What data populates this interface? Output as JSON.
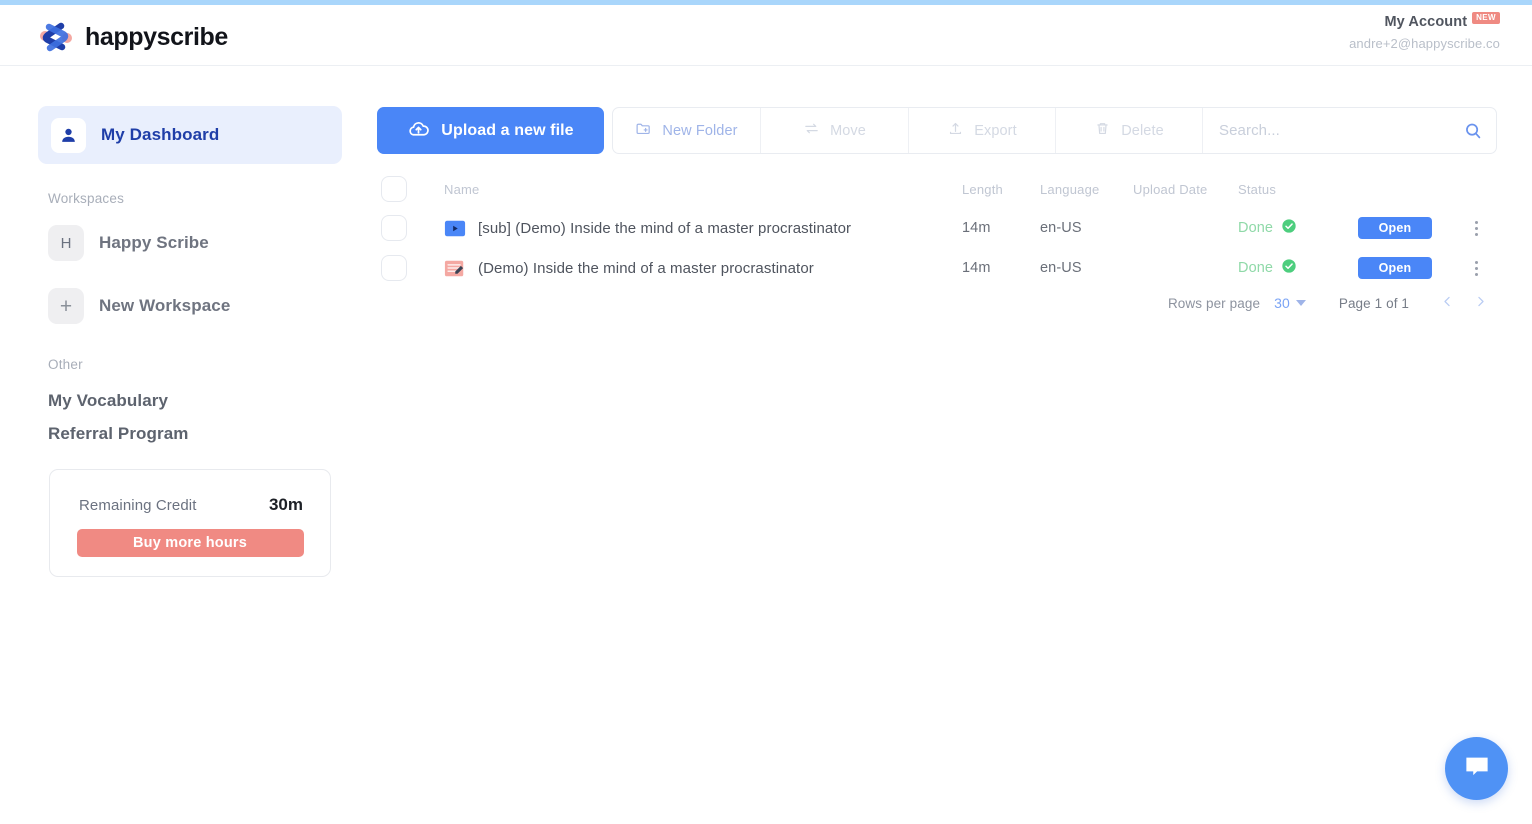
{
  "header": {
    "logo_text": "happyscribe",
    "logo_icon": "happyscribe-logo-icon",
    "account_name": "My Account",
    "new_badge": "NEW",
    "account_email": "andre+2@happyscribe.co"
  },
  "sidebar": {
    "dashboard": {
      "label": "My Dashboard",
      "icon": "person-icon"
    },
    "workspaces_label": "Workspaces",
    "workspaces": [
      {
        "initial": "H",
        "label": "Happy Scribe"
      },
      {
        "initial": "+",
        "label": "New Workspace"
      }
    ],
    "other_label": "Other",
    "other_links": [
      {
        "label": "My Vocabulary"
      },
      {
        "label": "Referral Program"
      }
    ],
    "credit": {
      "label": "Remaining Credit",
      "value": "30m",
      "buy_label": "Buy more hours"
    }
  },
  "toolbar": {
    "upload_label": "Upload a new file",
    "upload_icon": "cloud-upload-icon",
    "new_folder_label": "New Folder",
    "new_folder_icon": "folder-plus-icon",
    "move_label": "Move",
    "move_icon": "move-arrows-icon",
    "export_label": "Export",
    "export_icon": "export-upload-icon",
    "delete_label": "Delete",
    "delete_icon": "trash-icon",
    "search_placeholder": "Search...",
    "search_value": "",
    "search_icon": "search-icon"
  },
  "table": {
    "headers": {
      "name": "Name",
      "length": "Length",
      "language": "Language",
      "upload_date": "Upload Date",
      "status": "Status"
    },
    "rows": [
      {
        "icon": "video-subtitle-icon",
        "name": "[sub] (Demo) Inside the mind of a master procrastinator",
        "length": "14m",
        "language": "en-US",
        "upload_date": "",
        "status": "Done",
        "status_icon": "check-circle-icon",
        "action_label": "Open"
      },
      {
        "icon": "transcript-edit-icon",
        "name": "(Demo) Inside the mind of a master procrastinator",
        "length": "14m",
        "language": "en-US",
        "upload_date": "",
        "status": "Done",
        "status_icon": "check-circle-icon",
        "action_label": "Open"
      }
    ]
  },
  "pagination": {
    "rows_per_page_label": "Rows per page",
    "rows_per_page_value": "30",
    "page_info": "Page 1 of 1"
  },
  "chat": {
    "icon": "chat-bubble-icon"
  },
  "colors": {
    "primary_blue": "#4a86f7",
    "accent_salmon": "#f08a83",
    "status_green": "#8fd9a8",
    "active_nav_bg": "#e9effd",
    "top_strip": "#a9d6fb"
  }
}
